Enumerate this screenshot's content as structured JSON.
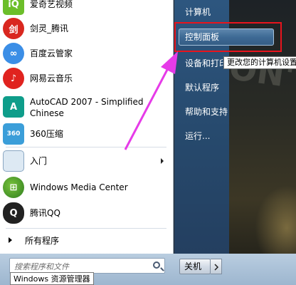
{
  "programs": [
    {
      "label": "爱奇艺视频",
      "icon": "iqiyi-icon",
      "glyph": "iQ"
    },
    {
      "label": "剑灵_腾讯",
      "icon": "jianling-icon",
      "glyph": "剑"
    },
    {
      "label": "百度云管家",
      "icon": "baidu-cloud-icon",
      "glyph": "∞"
    },
    {
      "label": "网易云音乐",
      "icon": "netease-music-icon",
      "glyph": "♪"
    },
    {
      "label": "AutoCAD 2007 - Simplified",
      "label2": "Chinese",
      "icon": "autocad-icon",
      "glyph": "A"
    },
    {
      "label": "360压缩",
      "icon": "360-zip-icon",
      "glyph": "360"
    },
    {
      "label": "入门",
      "icon": "getting-started-icon",
      "glyph": ""
    },
    {
      "label": "Windows Media Center",
      "icon": "windows-media-center-icon",
      "glyph": "⊞"
    },
    {
      "label": "腾讯QQ",
      "icon": "qq-penguin-icon",
      "glyph": "Q"
    }
  ],
  "all_programs": "所有程序",
  "search": {
    "placeholder": "搜索程序和文件"
  },
  "tooltip_bottom": "Windows 资源管理器",
  "right_menu": {
    "computer": "计算机",
    "control_panel": "控制面板",
    "devices": "设备和打印",
    "default_programs": "默认程序",
    "help": "帮助和支持",
    "run": "运行..."
  },
  "control_panel_tooltip": "更改您的计算机设置",
  "shutdown": "关机",
  "colors": {
    "highlight_box": "#e8141d",
    "arrow": "#e63be8"
  }
}
